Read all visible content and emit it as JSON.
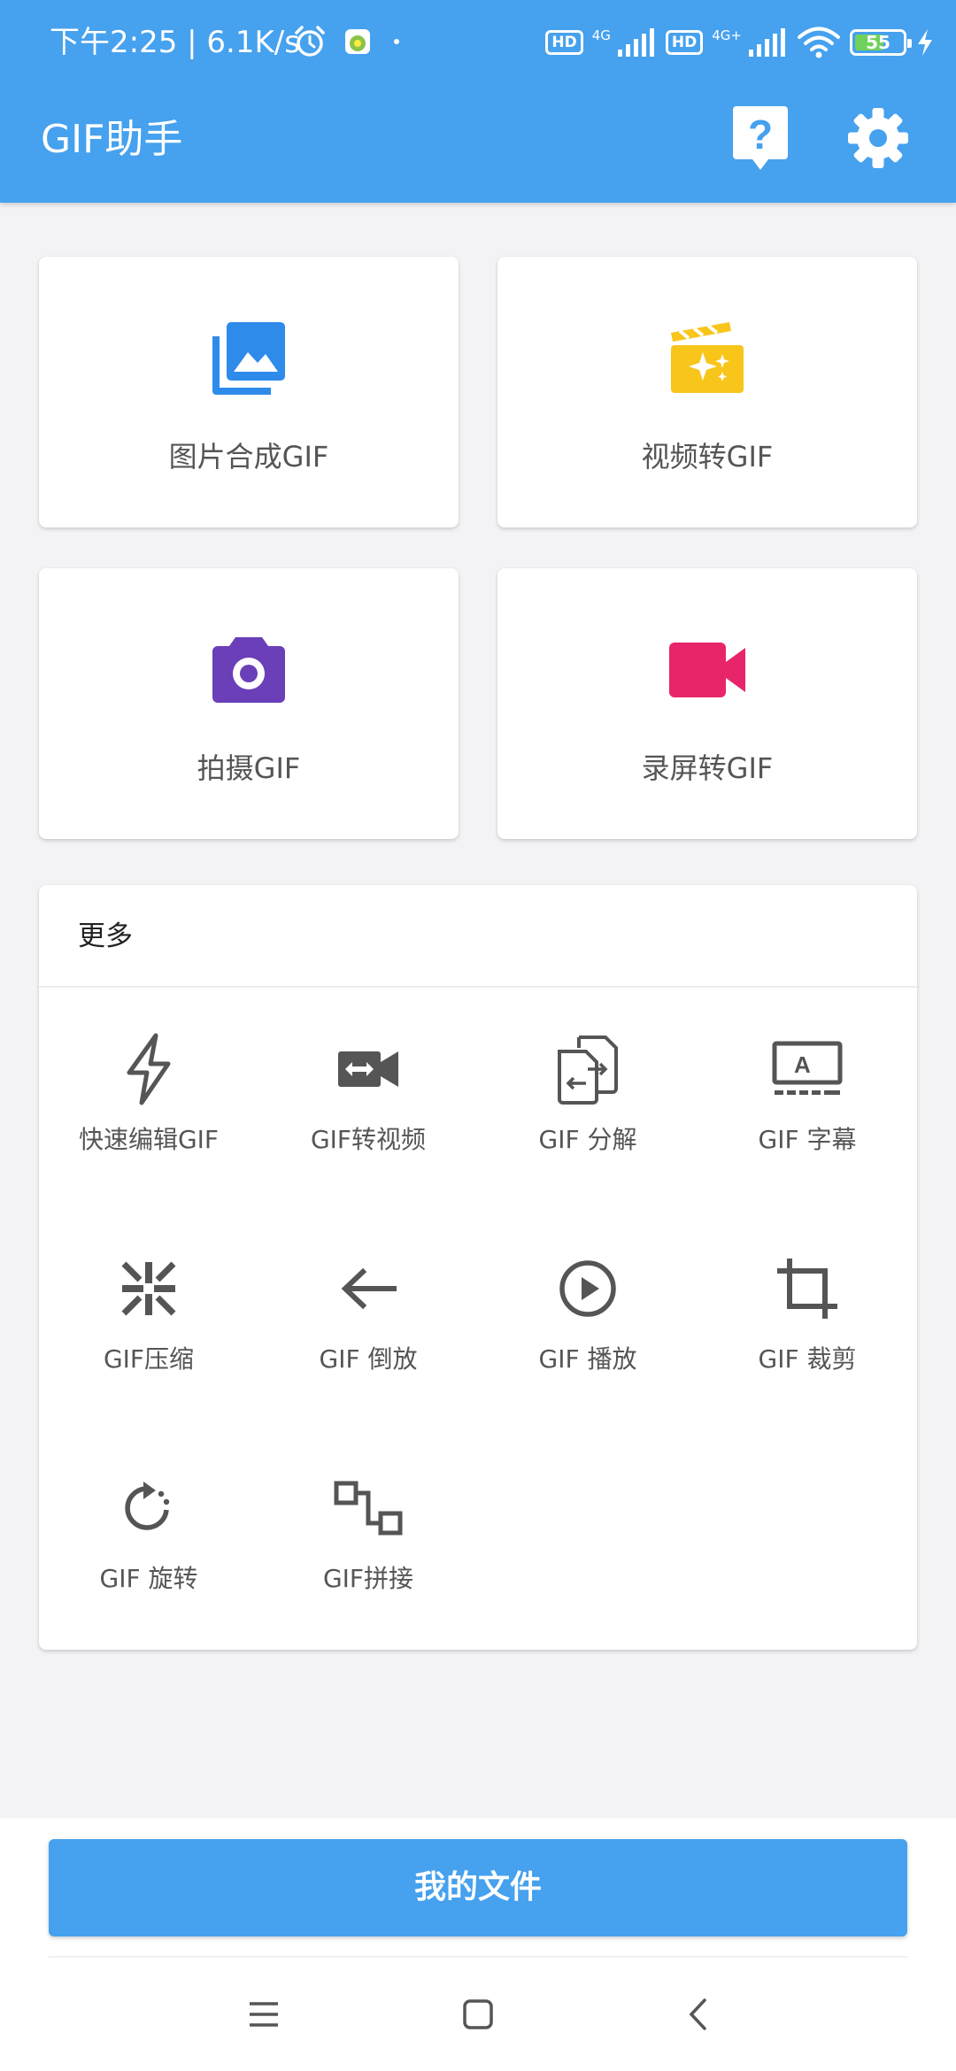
{
  "status_bar": {
    "time_speed": "下午2:25 | 6.1K/s",
    "hd1": "HD",
    "net1": "4G",
    "hd2": "HD",
    "net2": "4G+",
    "battery": "55"
  },
  "app_bar": {
    "title": "GIF助手",
    "help_icon": "help-icon",
    "settings_icon": "gear-icon"
  },
  "main_actions": [
    {
      "label": "图片合成GIF",
      "icon": "photo-library-icon",
      "color": "#2f8bea"
    },
    {
      "label": "视频转GIF",
      "icon": "movie-sparkle-icon",
      "color": "#f8c51a"
    },
    {
      "label": "拍摄GIF",
      "icon": "camera-icon",
      "color": "#6a3fb8"
    },
    {
      "label": "录屏转GIF",
      "icon": "videocam-icon",
      "color": "#e8246a"
    }
  ],
  "more": {
    "title": "更多",
    "tools": [
      {
        "label": "快速编辑GIF",
        "icon": "flash-icon"
      },
      {
        "label": "GIF转视频",
        "icon": "video-convert-icon"
      },
      {
        "label": "GIF 分解",
        "icon": "split-icon"
      },
      {
        "label": "GIF 字幕",
        "icon": "subtitle-icon"
      },
      {
        "label": "GIF压缩",
        "icon": "compress-icon"
      },
      {
        "label": "GIF 倒放",
        "icon": "arrow-left-icon"
      },
      {
        "label": "GIF 播放",
        "icon": "play-circle-icon"
      },
      {
        "label": "GIF 裁剪",
        "icon": "crop-icon"
      },
      {
        "label": "GIF 旋转",
        "icon": "rotate-icon"
      },
      {
        "label": "GIF拼接",
        "icon": "join-icon"
      }
    ]
  },
  "bottom": {
    "files_button": "我的文件"
  },
  "colors": {
    "primary": "#46a1ee",
    "background": "#f3f3f5"
  }
}
